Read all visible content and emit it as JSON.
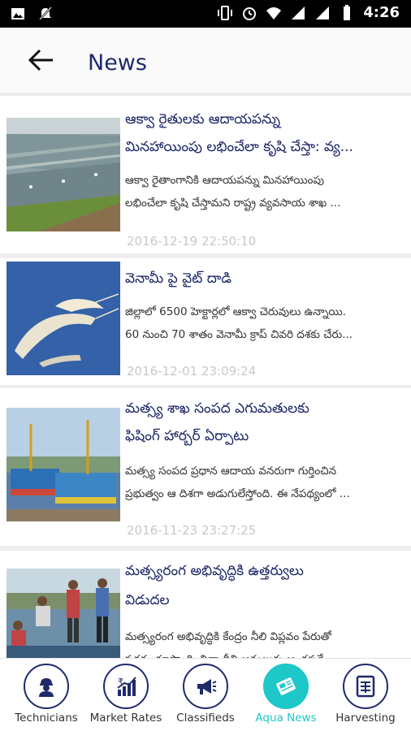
{
  "status_bar": {
    "time": "4:26",
    "left_icons": [
      "image-icon",
      "notifications-off-icon"
    ],
    "right_icons": [
      "vibrate-icon",
      "alarm-icon",
      "wifi-icon",
      "signal-icon",
      "signal-icon",
      "battery-icon"
    ]
  },
  "app_bar": {
    "back_icon": "arrow-back-icon",
    "title": "News"
  },
  "news": [
    {
      "title_line1": "ఆక్వా రైతులకు ఆదాయపన్ను",
      "title_line2": "మినహాయింపు లభించేలా కృషి చేస్తా: వ్య...",
      "desc_line1": "ఆక్వా రైతాంగానికి ఆదాయపన్ను మినహాయింపు",
      "desc_line2": "లభించేలా కృషి చేస్తామని రాష్ట్ర వ్యవసాయ శాఖ ...",
      "date": "2016-12-19 22:50:10",
      "thumb_icon": "aqua-ponds-image"
    },
    {
      "title_line1": "వెనామీ పై వైట్ దాడి",
      "desc_line1": "జిల్లాలో 6500 హెక్టార్లలో ఆక్వా చెరువులు ఉన్నాయి.",
      "desc_line2": "60 నుంచి 70 శాతం వెనామీ క్రాప్ చివరి దశకు చేరు...",
      "date": "2016-12-01 23:09:24",
      "thumb_icon": "shrimp-image"
    },
    {
      "title_line1": "మత్స్య శాఖ సంపద ఎగుమతులకు",
      "title_line2": "ఫిషింగ్ హార్బర్ ఏర్పాటు",
      "desc_line1": "మత్స్య సంపద ప్రధాన ఆదాయ వనరుగా గుర్తించిన",
      "desc_line2": "ప్రభుత్వం ఆ దిశగా అడుగులేస్తోంది. ఈ నేపథ్యంలో ...",
      "date": "2016-11-23 23:27:25",
      "thumb_icon": "fishing-boats-image"
    },
    {
      "title_line1": "మత్స్యరంగ అభివృద్ధికి ఉత్తర్వులు",
      "title_line2": "విడుదల",
      "desc_line1": "మత్స్యరంగ అభివృద్ధికి కేంద్రం నీలి విప్లవం పేరుతో",
      "desc_line2": "పథకం రూపొందించినా దీని అమలుకు ఆంధ్రప్రదే...",
      "thumb_icon": "fish-workers-image"
    }
  ],
  "bottom_nav": [
    {
      "label": "Technicians",
      "icon": "technician-icon",
      "active": false
    },
    {
      "label": "Market Rates",
      "icon": "market-rates-icon",
      "active": false
    },
    {
      "label": "Classifieds",
      "icon": "megaphone-icon",
      "active": false
    },
    {
      "label": "Aqua News",
      "icon": "newspaper-icon",
      "active": true
    },
    {
      "label": "Harvesting",
      "icon": "harvesting-icon",
      "active": false
    }
  ],
  "colors": {
    "primary": "#1f2a6b",
    "accent": "#1ec7c8",
    "date_text": "#c8c8c8"
  }
}
